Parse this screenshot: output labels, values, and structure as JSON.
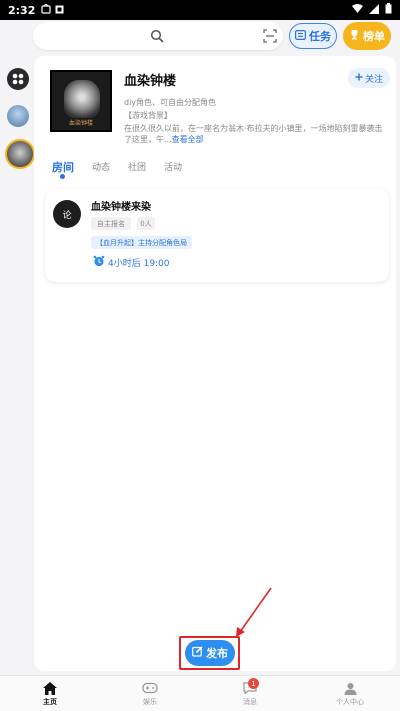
{
  "status_bar": {
    "time": "2:32"
  },
  "top_bar": {
    "search_placeholder": "",
    "task_label": "任务",
    "rank_label": "榜单"
  },
  "room": {
    "title": "血染钟楼",
    "follow_label": "关注",
    "cover_caption": "血染钟楼",
    "desc_line1": "diy角色、可自由分配角色",
    "desc_line2": "【游戏背景】",
    "desc_line3": "在很久很久以前，在一座名为翁木·布拉夫的小镇里，一场地陷刻雷暴袭击",
    "desc_line4_prefix": "了这里，午...",
    "desc_more": "查看全部"
  },
  "tabs": [
    {
      "label": "房间",
      "active": true
    },
    {
      "label": "动态",
      "active": false
    },
    {
      "label": "社团",
      "active": false
    },
    {
      "label": "活动",
      "active": false
    }
  ],
  "room_card": {
    "avatar_text": "论",
    "title": "血染钟楼来染",
    "chip_status": "自主报名",
    "chip_count": "0人",
    "tag": "【血月升起】主持分配角色局",
    "start_time": "4小时后 19:00"
  },
  "publish_label": "发布",
  "bottom_nav": [
    {
      "label": "主页",
      "icon": "home-icon",
      "active": true
    },
    {
      "label": "娱乐",
      "icon": "gamepad-icon",
      "active": false
    },
    {
      "label": "消息",
      "icon": "message-icon",
      "active": false,
      "badge": "1"
    },
    {
      "label": "个人中心",
      "icon": "user-icon",
      "active": false
    }
  ],
  "colors": {
    "accent": "#2a74e0",
    "publish": "#2f8ff0",
    "rank": "#f6b51d",
    "annotation": "#e0252b"
  }
}
